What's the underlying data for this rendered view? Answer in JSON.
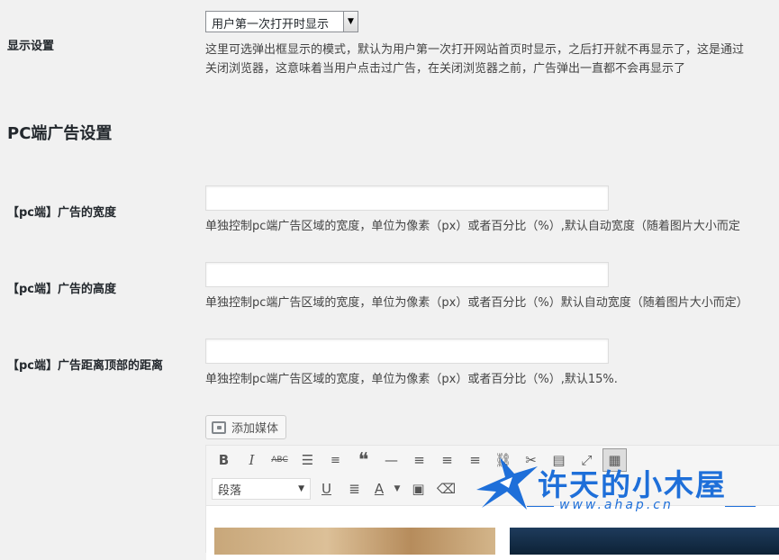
{
  "display_setting": {
    "label": "显示设置",
    "selected_option": "用户第一次打开时显示",
    "desc_line1": "这里可选弹出框显示的模式，默认为用户第一次打开网站首页时显示，之后打开就不再显示了，这是通过",
    "desc_line2": "关闭浏览器，这意味着当用户点击过广告，在关闭浏览器之前，广告弹出一直都不会再显示了"
  },
  "pc_section": {
    "title": "PC端广告设置"
  },
  "fields": [
    {
      "label": "【pc端】广告的宽度",
      "value": "",
      "desc": "单独控制pc端广告区域的宽度，单位为像素（px）或者百分比（%）,默认自动宽度（随着图片大小而定"
    },
    {
      "label": "【pc端】广告的高度",
      "value": "",
      "desc": "单独控制pc端广告区域的宽度，单位为像素（px）或者百分比（%）默认自动宽度（随着图片大小而定）"
    },
    {
      "label": "【pc端】广告距离顶部的距离",
      "value": "",
      "desc": "单独控制pc端广告区域的宽度，单位为像素（px）或者百分比（%）,默认15%."
    }
  ],
  "editor": {
    "add_media_label": "添加媒体",
    "format_select": "段落",
    "toolbar_row1_icons": [
      "bold-icon",
      "italic-icon",
      "strikethrough-icon",
      "bullet-list-icon",
      "numbered-list-icon",
      "blockquote-icon",
      "horizontal-line-icon",
      "align-left-icon",
      "align-center-icon",
      "align-right-icon",
      "link-icon",
      "unlink-icon",
      "read-more-icon",
      "fullscreen-icon",
      "toolbar-toggle-icon"
    ],
    "toolbar_row2_icons": [
      "underline-icon",
      "justify-icon",
      "text-color-icon",
      "paste-text-icon",
      "clear-formatting-icon"
    ]
  },
  "watermark": {
    "text": "许天的小木屋",
    "sub": "www.ahap.cn"
  },
  "colors": {
    "background": "#f1f1f1",
    "watermark": "#1e6fd9"
  }
}
